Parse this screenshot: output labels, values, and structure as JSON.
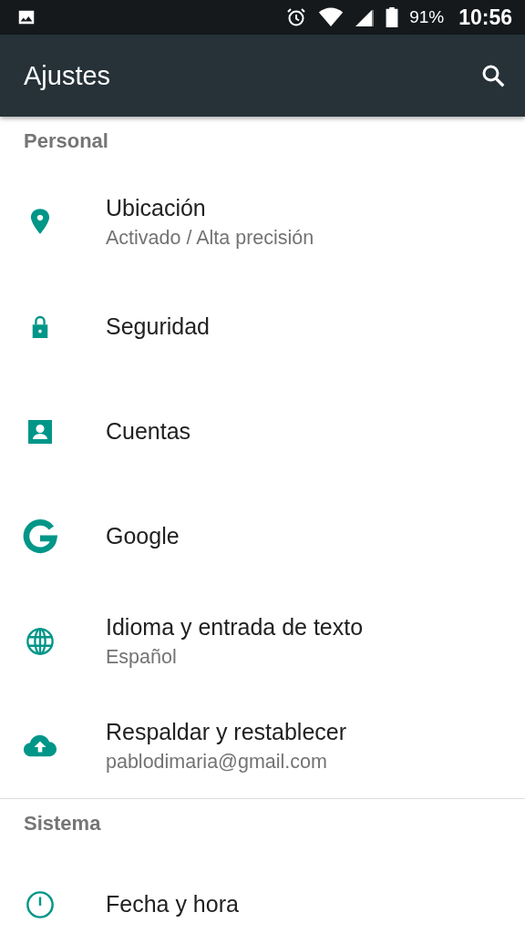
{
  "status_bar": {
    "battery": "91%",
    "time": "10:56"
  },
  "app_bar": {
    "title": "Ajustes"
  },
  "sections": [
    {
      "header": "Personal",
      "items": [
        {
          "kind": "location",
          "title": "Ubicación",
          "summary": "Activado / Alta precisión"
        },
        {
          "kind": "lock",
          "title": "Seguridad"
        },
        {
          "kind": "account",
          "title": "Cuentas"
        },
        {
          "kind": "google",
          "title": "Google"
        },
        {
          "kind": "language",
          "title": "Idioma y entrada de texto",
          "summary": "Español"
        },
        {
          "kind": "backup",
          "title": "Respaldar y restablecer",
          "summary": "pablodimaria@gmail.com"
        }
      ]
    },
    {
      "header": "Sistema",
      "items": [
        {
          "kind": "clock",
          "title": "Fecha y hora"
        }
      ]
    }
  ]
}
